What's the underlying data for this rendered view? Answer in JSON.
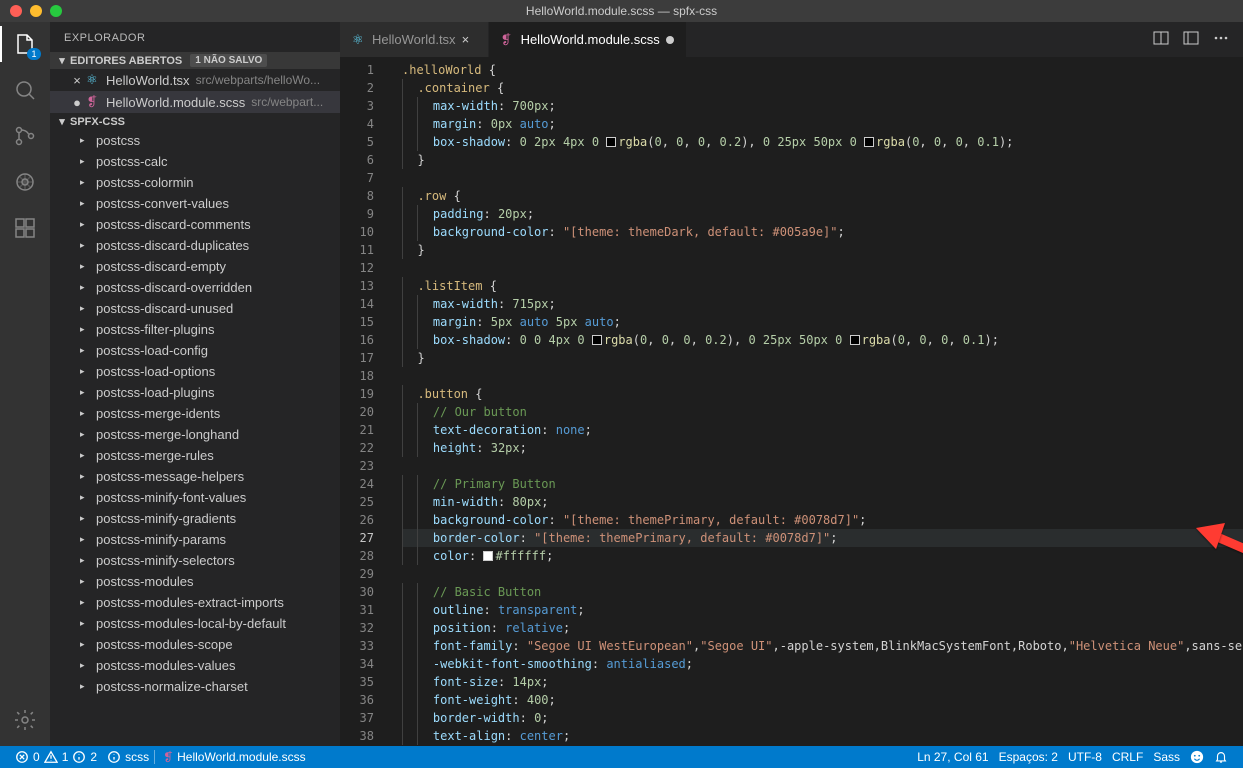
{
  "window": {
    "title": "HelloWorld.module.scss — spfx-css"
  },
  "activity": {
    "explorer_badge": "1"
  },
  "sidebar": {
    "title": "EXPLORADOR",
    "open_editors": {
      "label": "EDITORES ABERTOS",
      "unsaved_badge": "1 NÃO SALVO",
      "items": [
        {
          "name": "HelloWorld.tsx",
          "path": "src/webparts/helloWo...",
          "dirty": false,
          "icon": "react"
        },
        {
          "name": "HelloWorld.module.scss",
          "path": "src/webpart...",
          "dirty": true,
          "icon": "sass",
          "selected": true
        }
      ]
    },
    "project": {
      "name": "SPFX-CSS",
      "folders": [
        "postcss",
        "postcss-calc",
        "postcss-colormin",
        "postcss-convert-values",
        "postcss-discard-comments",
        "postcss-discard-duplicates",
        "postcss-discard-empty",
        "postcss-discard-overridden",
        "postcss-discard-unused",
        "postcss-filter-plugins",
        "postcss-load-config",
        "postcss-load-options",
        "postcss-load-plugins",
        "postcss-merge-idents",
        "postcss-merge-longhand",
        "postcss-merge-rules",
        "postcss-message-helpers",
        "postcss-minify-font-values",
        "postcss-minify-gradients",
        "postcss-minify-params",
        "postcss-minify-selectors",
        "postcss-modules",
        "postcss-modules-extract-imports",
        "postcss-modules-local-by-default",
        "postcss-modules-scope",
        "postcss-modules-values",
        "postcss-normalize-charset"
      ]
    }
  },
  "tabs": [
    {
      "label": "HelloWorld.tsx",
      "icon": "react",
      "active": false,
      "dirty": false
    },
    {
      "label": "HelloWorld.module.scss",
      "icon": "sass",
      "active": true,
      "dirty": true
    }
  ],
  "code": {
    "current_line": 27,
    "lines": [
      {
        "n": 1,
        "tokens": [
          {
            "t": ".helloWorld ",
            "c": "c-sel"
          },
          {
            "t": "{",
            "c": "c-brace"
          }
        ]
      },
      {
        "n": 2,
        "indent": 1,
        "tokens": [
          {
            "t": ".container ",
            "c": "c-sel"
          },
          {
            "t": "{",
            "c": "c-brace"
          }
        ]
      },
      {
        "n": 3,
        "indent": 2,
        "tokens": [
          {
            "t": "max-width",
            "c": "c-prop"
          },
          {
            "t": ": "
          },
          {
            "t": "700px",
            "c": "c-num"
          },
          {
            "t": ";"
          }
        ]
      },
      {
        "n": 4,
        "indent": 2,
        "tokens": [
          {
            "t": "margin",
            "c": "c-prop"
          },
          {
            "t": ": "
          },
          {
            "t": "0px ",
            "c": "c-num"
          },
          {
            "t": "auto",
            "c": "c-const"
          },
          {
            "t": ";"
          }
        ]
      },
      {
        "n": 5,
        "indent": 2,
        "tokens": [
          {
            "t": "box-shadow",
            "c": "c-prop"
          },
          {
            "t": ": "
          },
          {
            "t": "0 2px 4px 0 ",
            "c": "c-num"
          },
          {
            "sq": "#000"
          },
          {
            "t": "rgba",
            "c": "c-fn"
          },
          {
            "t": "("
          },
          {
            "t": "0",
            "c": "c-num"
          },
          {
            "t": ", "
          },
          {
            "t": "0",
            "c": "c-num"
          },
          {
            "t": ", "
          },
          {
            "t": "0",
            "c": "c-num"
          },
          {
            "t": ", "
          },
          {
            "t": "0.2",
            "c": "c-num"
          },
          {
            "t": "), "
          },
          {
            "t": "0 25px 50px 0 ",
            "c": "c-num"
          },
          {
            "sq": "#000"
          },
          {
            "t": "rgba",
            "c": "c-fn"
          },
          {
            "t": "("
          },
          {
            "t": "0",
            "c": "c-num"
          },
          {
            "t": ", "
          },
          {
            "t": "0",
            "c": "c-num"
          },
          {
            "t": ", "
          },
          {
            "t": "0",
            "c": "c-num"
          },
          {
            "t": ", "
          },
          {
            "t": "0.1",
            "c": "c-num"
          },
          {
            "t": ");"
          }
        ]
      },
      {
        "n": 6,
        "indent": 1,
        "tokens": [
          {
            "t": "}",
            "c": "c-brace"
          }
        ]
      },
      {
        "n": 7,
        "tokens": []
      },
      {
        "n": 8,
        "indent": 1,
        "tokens": [
          {
            "t": ".row ",
            "c": "c-sel"
          },
          {
            "t": "{",
            "c": "c-brace"
          }
        ]
      },
      {
        "n": 9,
        "indent": 2,
        "tokens": [
          {
            "t": "padding",
            "c": "c-prop"
          },
          {
            "t": ": "
          },
          {
            "t": "20px",
            "c": "c-num"
          },
          {
            "t": ";"
          }
        ]
      },
      {
        "n": 10,
        "indent": 2,
        "tokens": [
          {
            "t": "background-color",
            "c": "c-prop"
          },
          {
            "t": ": "
          },
          {
            "t": "\"[theme: themeDark, default: #005a9e]\"",
            "c": "c-str"
          },
          {
            "t": ";"
          }
        ]
      },
      {
        "n": 11,
        "indent": 1,
        "tokens": [
          {
            "t": "}",
            "c": "c-brace"
          }
        ]
      },
      {
        "n": 12,
        "tokens": []
      },
      {
        "n": 13,
        "indent": 1,
        "tokens": [
          {
            "t": ".listItem ",
            "c": "c-sel"
          },
          {
            "t": "{",
            "c": "c-brace"
          }
        ]
      },
      {
        "n": 14,
        "indent": 2,
        "tokens": [
          {
            "t": "max-width",
            "c": "c-prop"
          },
          {
            "t": ": "
          },
          {
            "t": "715px",
            "c": "c-num"
          },
          {
            "t": ";"
          }
        ]
      },
      {
        "n": 15,
        "indent": 2,
        "tokens": [
          {
            "t": "margin",
            "c": "c-prop"
          },
          {
            "t": ": "
          },
          {
            "t": "5px ",
            "c": "c-num"
          },
          {
            "t": "auto ",
            "c": "c-const"
          },
          {
            "t": "5px ",
            "c": "c-num"
          },
          {
            "t": "auto",
            "c": "c-const"
          },
          {
            "t": ";"
          }
        ]
      },
      {
        "n": 16,
        "indent": 2,
        "tokens": [
          {
            "t": "box-shadow",
            "c": "c-prop"
          },
          {
            "t": ": "
          },
          {
            "t": "0 0 4px 0 ",
            "c": "c-num"
          },
          {
            "sq": "#000"
          },
          {
            "t": "rgba",
            "c": "c-fn"
          },
          {
            "t": "("
          },
          {
            "t": "0",
            "c": "c-num"
          },
          {
            "t": ", "
          },
          {
            "t": "0",
            "c": "c-num"
          },
          {
            "t": ", "
          },
          {
            "t": "0",
            "c": "c-num"
          },
          {
            "t": ", "
          },
          {
            "t": "0.2",
            "c": "c-num"
          },
          {
            "t": "), "
          },
          {
            "t": "0 25px 50px 0 ",
            "c": "c-num"
          },
          {
            "sq": "#000"
          },
          {
            "t": "rgba",
            "c": "c-fn"
          },
          {
            "t": "("
          },
          {
            "t": "0",
            "c": "c-num"
          },
          {
            "t": ", "
          },
          {
            "t": "0",
            "c": "c-num"
          },
          {
            "t": ", "
          },
          {
            "t": "0",
            "c": "c-num"
          },
          {
            "t": ", "
          },
          {
            "t": "0.1",
            "c": "c-num"
          },
          {
            "t": ");"
          }
        ]
      },
      {
        "n": 17,
        "indent": 1,
        "tokens": [
          {
            "t": "}",
            "c": "c-brace"
          }
        ]
      },
      {
        "n": 18,
        "tokens": []
      },
      {
        "n": 19,
        "indent": 1,
        "tokens": [
          {
            "t": ".button ",
            "c": "c-sel"
          },
          {
            "t": "{",
            "c": "c-brace"
          }
        ]
      },
      {
        "n": 20,
        "indent": 2,
        "tokens": [
          {
            "t": "// Our button",
            "c": "c-cmt"
          }
        ]
      },
      {
        "n": 21,
        "indent": 2,
        "tokens": [
          {
            "t": "text-decoration",
            "c": "c-prop"
          },
          {
            "t": ": "
          },
          {
            "t": "none",
            "c": "c-const"
          },
          {
            "t": ";"
          }
        ]
      },
      {
        "n": 22,
        "indent": 2,
        "tokens": [
          {
            "t": "height",
            "c": "c-prop"
          },
          {
            "t": ": "
          },
          {
            "t": "32px",
            "c": "c-num"
          },
          {
            "t": ";"
          }
        ]
      },
      {
        "n": 23,
        "tokens": []
      },
      {
        "n": 24,
        "indent": 2,
        "tokens": [
          {
            "t": "// Primary Button",
            "c": "c-cmt"
          }
        ]
      },
      {
        "n": 25,
        "indent": 2,
        "tokens": [
          {
            "t": "min-width",
            "c": "c-prop"
          },
          {
            "t": ": "
          },
          {
            "t": "80px",
            "c": "c-num"
          },
          {
            "t": ";"
          }
        ]
      },
      {
        "n": 26,
        "indent": 2,
        "tokens": [
          {
            "t": "background-color",
            "c": "c-prop"
          },
          {
            "t": ": "
          },
          {
            "t": "\"[theme: themePrimary, default: #0078d7]\"",
            "c": "c-str"
          },
          {
            "t": ";"
          }
        ]
      },
      {
        "n": 27,
        "indent": 2,
        "hl": true,
        "tokens": [
          {
            "t": "border-color",
            "c": "c-prop"
          },
          {
            "t": ": "
          },
          {
            "t": "\"[theme: themePrimary, default: #0078d7]\"",
            "c": "c-str"
          },
          {
            "t": ";"
          }
        ]
      },
      {
        "n": 28,
        "indent": 2,
        "tokens": [
          {
            "t": "color",
            "c": "c-prop"
          },
          {
            "t": ": "
          },
          {
            "sq": "#fff"
          },
          {
            "t": "#ffffff",
            "c": "c-num"
          },
          {
            "t": ";"
          }
        ]
      },
      {
        "n": 29,
        "tokens": []
      },
      {
        "n": 30,
        "indent": 2,
        "tokens": [
          {
            "t": "// Basic Button",
            "c": "c-cmt"
          }
        ]
      },
      {
        "n": 31,
        "indent": 2,
        "tokens": [
          {
            "t": "outline",
            "c": "c-prop"
          },
          {
            "t": ": "
          },
          {
            "t": "transparent",
            "c": "c-const"
          },
          {
            "t": ";"
          }
        ]
      },
      {
        "n": 32,
        "indent": 2,
        "tokens": [
          {
            "t": "position",
            "c": "c-prop"
          },
          {
            "t": ": "
          },
          {
            "t": "relative",
            "c": "c-const"
          },
          {
            "t": ";"
          }
        ]
      },
      {
        "n": 33,
        "indent": 2,
        "tokens": [
          {
            "t": "font-family",
            "c": "c-prop"
          },
          {
            "t": ": "
          },
          {
            "t": "\"Segoe UI WestEuropean\"",
            "c": "c-str"
          },
          {
            "t": ","
          },
          {
            "t": "\"Segoe UI\"",
            "c": "c-str"
          },
          {
            "t": ",-apple-system,BlinkMacSystemFont,Roboto,"
          },
          {
            "t": "\"Helvetica Neue\"",
            "c": "c-str"
          },
          {
            "t": ",sans-se"
          }
        ]
      },
      {
        "n": 34,
        "indent": 2,
        "tokens": [
          {
            "t": "-webkit-font-smoothing",
            "c": "c-prop"
          },
          {
            "t": ": "
          },
          {
            "t": "antialiased",
            "c": "c-const"
          },
          {
            "t": ";"
          }
        ]
      },
      {
        "n": 35,
        "indent": 2,
        "tokens": [
          {
            "t": "font-size",
            "c": "c-prop"
          },
          {
            "t": ": "
          },
          {
            "t": "14px",
            "c": "c-num"
          },
          {
            "t": ";"
          }
        ]
      },
      {
        "n": 36,
        "indent": 2,
        "tokens": [
          {
            "t": "font-weight",
            "c": "c-prop"
          },
          {
            "t": ": "
          },
          {
            "t": "400",
            "c": "c-num"
          },
          {
            "t": ";"
          }
        ]
      },
      {
        "n": 37,
        "indent": 2,
        "tokens": [
          {
            "t": "border-width",
            "c": "c-prop"
          },
          {
            "t": ": "
          },
          {
            "t": "0",
            "c": "c-num"
          },
          {
            "t": ";"
          }
        ]
      },
      {
        "n": 38,
        "indent": 2,
        "tokens": [
          {
            "t": "text-align",
            "c": "c-prop"
          },
          {
            "t": ": "
          },
          {
            "t": "center",
            "c": "c-const"
          },
          {
            "t": ";"
          }
        ]
      }
    ]
  },
  "status": {
    "errors": "0",
    "warnings": "1",
    "infos": "2",
    "lang_status": "scss",
    "file": "HelloWorld.module.scss",
    "cursor": "Ln 27, Col 61",
    "indent": "Espaços: 2",
    "encoding": "UTF-8",
    "eol": "CRLF",
    "lang": "Sass"
  }
}
